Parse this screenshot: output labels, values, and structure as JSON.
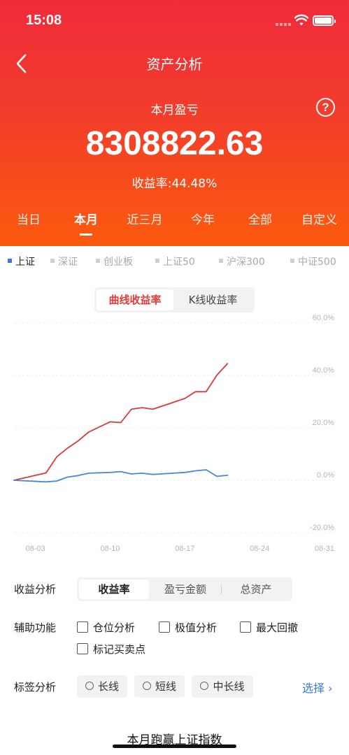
{
  "status": {
    "time": "15:08"
  },
  "header": {
    "title": "资产分析",
    "subtitle": "本月盈亏",
    "amount": "8308822.63",
    "rate_text": "收益率:44.48%",
    "help_symbol": "?"
  },
  "period_tabs": [
    {
      "label": "当日",
      "active": false
    },
    {
      "label": "本月",
      "active": true
    },
    {
      "label": "近三月",
      "active": false
    },
    {
      "label": "今年",
      "active": false
    },
    {
      "label": "全部",
      "active": false
    },
    {
      "label": "自定义",
      "active": false
    }
  ],
  "index_filters": [
    {
      "label": "上证",
      "active": true
    },
    {
      "label": "深证",
      "active": false
    },
    {
      "label": "创业板",
      "active": false
    },
    {
      "label": "上证50",
      "active": false
    },
    {
      "label": "沪深300",
      "active": false
    },
    {
      "label": "中证500",
      "active": false
    }
  ],
  "chart_toggle": [
    {
      "label": "曲线收益率",
      "active": true
    },
    {
      "label": "K线收益率",
      "active": false
    }
  ],
  "chart_data": {
    "type": "line",
    "x_ticks": [
      "08-03",
      "08-10",
      "08-17",
      "08-24",
      "08-31"
    ],
    "y_ticks": [
      "60.0%",
      "40.0%",
      "20.0%",
      "0.0%",
      "-20.0%"
    ],
    "ylim": [
      -20,
      60
    ],
    "xlim": [
      "08-01",
      "08-31"
    ],
    "grid": true,
    "series": [
      {
        "color": "#d93a3a",
        "points": [
          {
            "x": "08-01",
            "y": 0.0
          },
          {
            "x": "08-04",
            "y": 2.8
          },
          {
            "x": "08-05",
            "y": 8.9
          },
          {
            "x": "08-06",
            "y": 12.2
          },
          {
            "x": "08-07",
            "y": 15.0
          },
          {
            "x": "08-08",
            "y": 18.4
          },
          {
            "x": "08-10",
            "y": 22.3
          },
          {
            "x": "08-11",
            "y": 22.0
          },
          {
            "x": "08-12",
            "y": 27.1
          },
          {
            "x": "08-13",
            "y": 27.7
          },
          {
            "x": "08-14",
            "y": 27.1
          },
          {
            "x": "08-17",
            "y": 31.2
          },
          {
            "x": "08-18",
            "y": 33.8
          },
          {
            "x": "08-19",
            "y": 33.8
          },
          {
            "x": "08-20",
            "y": 40.1
          },
          {
            "x": "08-21",
            "y": 44.5
          }
        ]
      },
      {
        "color": "#4a86d8",
        "points": [
          {
            "x": "08-01",
            "y": 0.0
          },
          {
            "x": "08-04",
            "y": -0.6
          },
          {
            "x": "08-05",
            "y": -0.3
          },
          {
            "x": "08-06",
            "y": 1.2
          },
          {
            "x": "08-07",
            "y": 1.8
          },
          {
            "x": "08-08",
            "y": 2.7
          },
          {
            "x": "08-10",
            "y": 3.0
          },
          {
            "x": "08-11",
            "y": 3.3
          },
          {
            "x": "08-12",
            "y": 2.4
          },
          {
            "x": "08-13",
            "y": 2.7
          },
          {
            "x": "08-14",
            "y": 2.2
          },
          {
            "x": "08-17",
            "y": 3.0
          },
          {
            "x": "08-18",
            "y": 3.6
          },
          {
            "x": "08-19",
            "y": 4.0
          },
          {
            "x": "08-20",
            "y": 1.5
          },
          {
            "x": "08-21",
            "y": 1.9
          }
        ]
      }
    ]
  },
  "income_analysis": {
    "label": "收益分析",
    "options": [
      {
        "label": "收益率",
        "active": true
      },
      {
        "label": "盈亏金额",
        "active": false
      },
      {
        "label": "总资产",
        "active": false
      }
    ]
  },
  "aux": {
    "label": "辅助功能",
    "options": [
      {
        "label": "仓位分析",
        "checked": false
      },
      {
        "label": "极值分析",
        "checked": false
      },
      {
        "label": "最大回撤",
        "checked": false
      },
      {
        "label": "标记买卖点",
        "checked": false
      }
    ]
  },
  "tag_analysis": {
    "label": "标签分析",
    "options": [
      {
        "label": "长线"
      },
      {
        "label": "短线"
      },
      {
        "label": "中长线"
      }
    ],
    "select_label": "选择",
    "select_chevron": "›"
  },
  "bottom": {
    "title": "本月跑赢上证指数"
  }
}
